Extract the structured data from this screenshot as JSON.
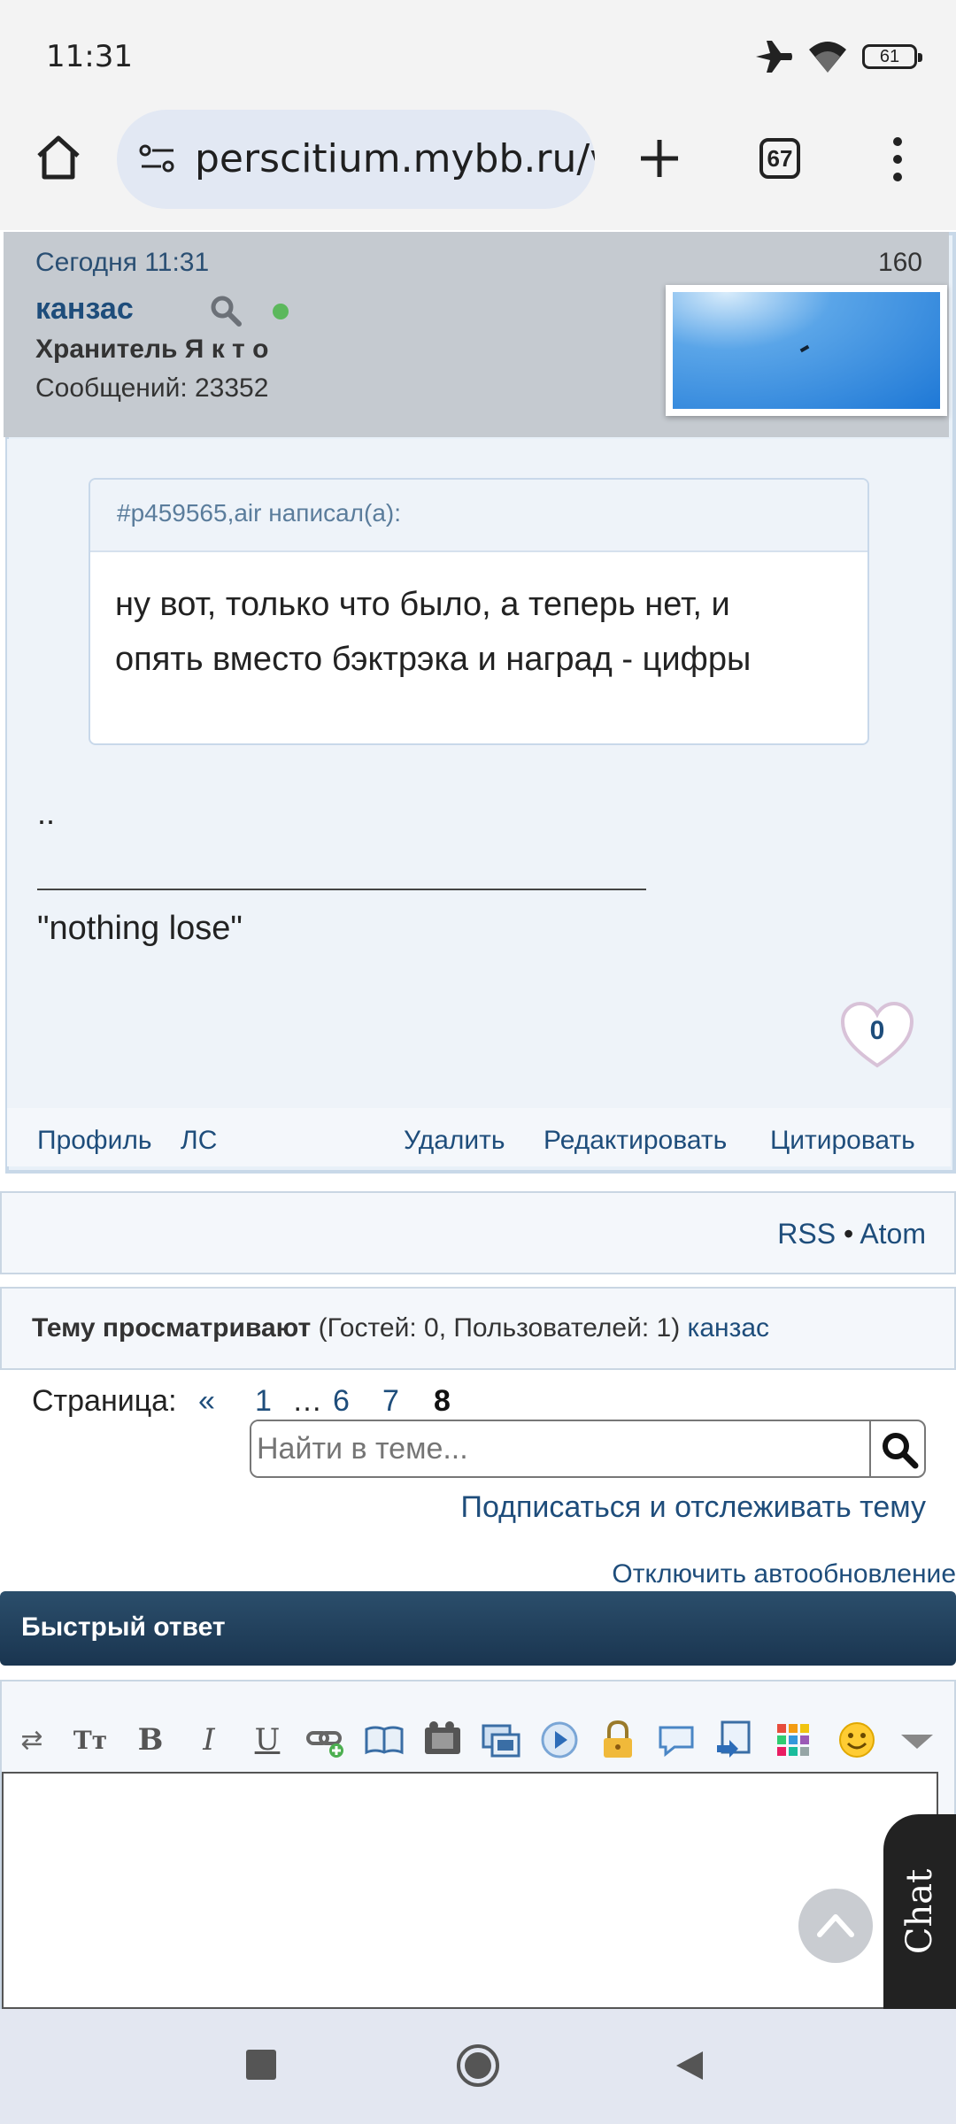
{
  "status_bar": {
    "time": "11:31",
    "battery": "61"
  },
  "browser": {
    "url": "perscitium.mybb.ru/v",
    "tab_count": "67"
  },
  "post": {
    "date": "Сегодня 11:31",
    "post_number": "160",
    "author": "канзас",
    "rank": "Хранитель Я к т о",
    "messages": "Сообщений: 23352",
    "quote_header": "#p459565,air написал(а):",
    "quote_text_line1": "ну вот, только что было, а теперь нет, и",
    "quote_text_line2": "опять вместо бэктрэка и наград - цифры",
    "body_text": "..",
    "signature": "\"nothing lose\"",
    "likes": "0",
    "actions": {
      "profile": "Профиль",
      "pm": "ЛС",
      "delete": "Удалить",
      "edit": "Редактировать",
      "quote": "Цитировать"
    }
  },
  "feeds": {
    "rss": "RSS",
    "sep": "•",
    "atom": "Atom"
  },
  "viewers": {
    "label": "Тему просматривают",
    "counts": "(Гостей: 0, Пользователей: 1)",
    "user": "канзас"
  },
  "pagination": {
    "label": "Страница:",
    "prev": "«",
    "pages": [
      "1",
      "…",
      "6",
      "7",
      "8"
    ],
    "current": "8"
  },
  "search": {
    "placeholder": "Найти в теме..."
  },
  "subscribe": "Подписаться и отслеживать тему",
  "autoupdate": "Отключить автообновление",
  "quick_reply": {
    "title": "Быстрый ответ"
  },
  "chat": {
    "label": "Chat"
  },
  "colors": {
    "link": "#1e4d7b",
    "header_bar": "#1f3d5a",
    "post_head": "#c5cad0"
  }
}
